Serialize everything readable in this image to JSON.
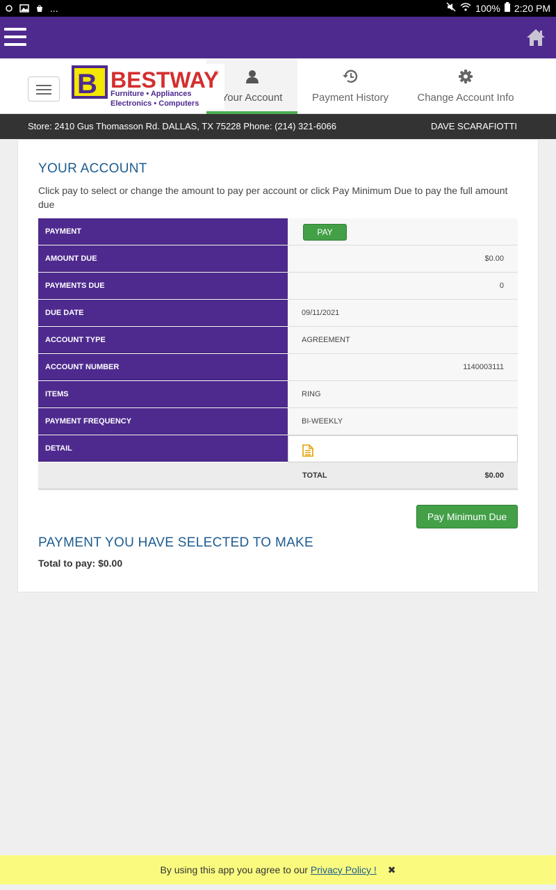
{
  "status_bar": {
    "battery": "100%",
    "time": "2:20 PM",
    "notif_more": "..."
  },
  "nav": {
    "logo_text": "BESTWAY",
    "logo_reg": "®",
    "logo_letter": "B",
    "logo_tagline1": "Furniture • Appliances",
    "logo_tagline2": "Electronics • Computers",
    "tabs": [
      {
        "label": "Your Account",
        "icon": "user-icon"
      },
      {
        "label": "Payment History",
        "icon": "history-icon"
      },
      {
        "label": "Change Account Info",
        "icon": "gear-icon"
      }
    ]
  },
  "store_bar": {
    "address": "Store: 2410 Gus Thomasson Rd. DALLAS, TX 75228 Phone: (214) 321-6066",
    "user": "DAVE SCARAFIOTTI"
  },
  "account": {
    "title": "YOUR ACCOUNT",
    "description": "Click pay to select or change the amount to pay per account or click Pay Minimum Due to pay the full amount due",
    "rows": {
      "payment": {
        "label": "PAYMENT",
        "button": "PAY"
      },
      "amount_due": {
        "label": "AMOUNT DUE",
        "value": "$0.00"
      },
      "payments_due": {
        "label": "PAYMENTS DUE",
        "value": "0"
      },
      "due_date": {
        "label": "DUE DATE",
        "value": "09/11/2021"
      },
      "account_type": {
        "label": "ACCOUNT TYPE",
        "value": "AGREEMENT"
      },
      "account_number": {
        "label": "ACCOUNT NUMBER",
        "value": "1140003111"
      },
      "items": {
        "label": "ITEMS",
        "value": "RING"
      },
      "payment_frequency": {
        "label": "PAYMENT FREQUENCY",
        "value": "BI-WEEKLY"
      },
      "detail": {
        "label": "DETAIL",
        "icon": "document-icon"
      }
    },
    "total": {
      "label": "TOTAL",
      "value": "$0.00"
    },
    "min_due_button": "Pay Minimum Due"
  },
  "selected": {
    "title": "PAYMENT YOU HAVE SELECTED TO MAKE",
    "total_text": "Total to pay: $0.00"
  },
  "footer": {
    "text": "By using this app you agree to our",
    "link": "Privacy Policy !",
    "close": "✖"
  },
  "colors": {
    "brand_purple": "#4e2a8e",
    "accent_green": "#43a047",
    "title_blue": "#1d5b8f",
    "footer_yellow": "#fafb7e"
  }
}
